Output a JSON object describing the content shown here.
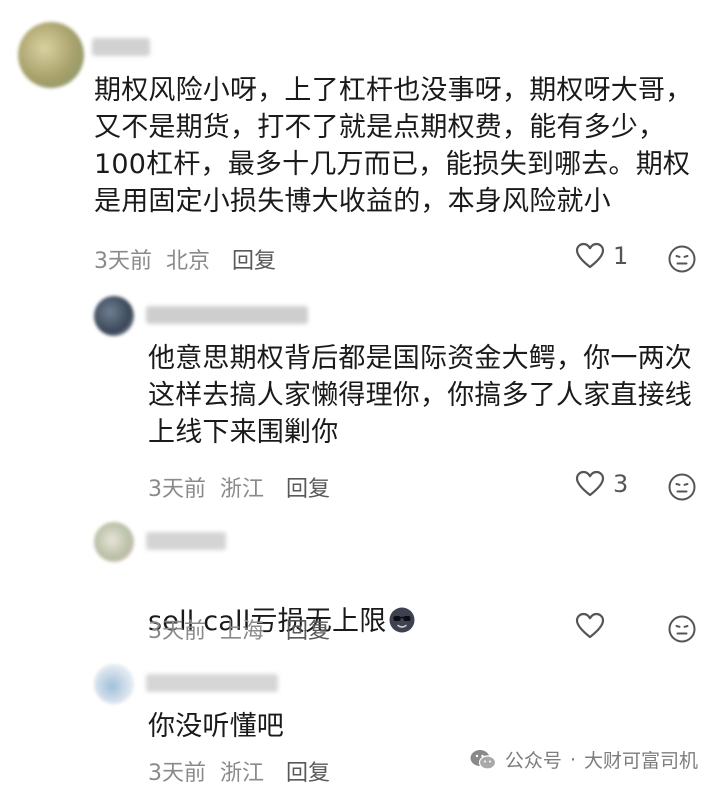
{
  "comments": [
    {
      "text": "期权风险小呀，上了杠杆也没事呀，期权呀大哥，\n又不是期货，打不了就是点期权费，能有多少，\n100杠杆，最多十几万而已，能损失到哪去。期权\n是用固定小损失博大收益的，本身风险就小",
      "time": "3天前",
      "location": "北京",
      "reply_label": "回复",
      "like_count": "1",
      "avatar_icon": "blurred-avatar",
      "like_icon": "heart-outline-icon",
      "emoji_icon": "neutral-face-icon"
    },
    {
      "text": "他意思期权背后都是国际资金大鳄，你一两次\n这样去搞人家懒得理你，你搞多了人家直接线\n上线下来围剿你",
      "time": "3天前",
      "location": "浙江",
      "reply_label": "回复",
      "like_count": "3",
      "avatar_icon": "blurred-avatar",
      "like_icon": "heart-outline-icon",
      "emoji_icon": "neutral-face-icon"
    },
    {
      "text": "sell call亏损无上限",
      "time": "3天前",
      "location": "上海",
      "reply_label": "回复",
      "like_count": "",
      "avatar_icon": "blurred-avatar",
      "like_icon": "heart-outline-icon",
      "emoji_icon": "neutral-face-icon",
      "inline_emoji": "sunglasses-face-icon"
    },
    {
      "text": "你没听懂吧",
      "time": "3天前",
      "location": "浙江",
      "reply_label": "回复",
      "like_count": "",
      "avatar_icon": "blurred-avatar",
      "like_icon": "heart-outline-icon",
      "emoji_icon": "neutral-face-icon"
    }
  ],
  "watermark": {
    "prefix": "公众号",
    "separator": "·",
    "name": "大财可富司机",
    "icon": "wechat-icon"
  },
  "colors": {
    "text": "#1a1a1a",
    "meta": "#8a8a8a",
    "reply": "#595959",
    "icon": "#555555"
  }
}
